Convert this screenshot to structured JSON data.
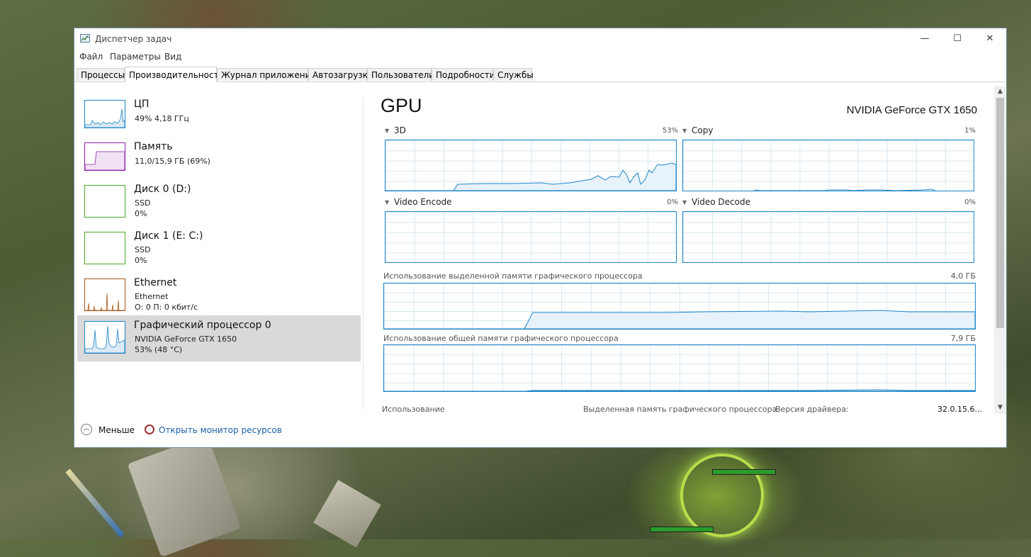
{
  "window": {
    "title": "Диспетчер задач",
    "controls": {
      "minimize": "—",
      "maximize": "☐",
      "close": "✕"
    }
  },
  "menu": [
    "Файл",
    "Параметры",
    "Вид"
  ],
  "tabs": [
    {
      "label": "Процессы",
      "active": false
    },
    {
      "label": "Производительность",
      "active": true
    },
    {
      "label": "Журнал приложений",
      "active": false
    },
    {
      "label": "Автозагрузка",
      "active": false
    },
    {
      "label": "Пользователи",
      "active": false
    },
    {
      "label": "Подробности",
      "active": false
    },
    {
      "label": "Службы",
      "active": false
    }
  ],
  "resources": [
    {
      "title": "ЦП",
      "line1": "49% 4,18 ГГц",
      "line2": "",
      "color": "#1e86c8",
      "selected": false
    },
    {
      "title": "Память",
      "line1": "11,0/15,9 ГБ (69%)",
      "line2": "",
      "color": "#8b1fa8",
      "selected": false
    },
    {
      "title": "Диск 0 (D:)",
      "line1": "SSD",
      "line2": "0%",
      "color": "#4da626",
      "selected": false
    },
    {
      "title": "Диск 1 (E: C:)",
      "line1": "SSD",
      "line2": "0%",
      "color": "#4da626",
      "selected": false
    },
    {
      "title": "Ethernet",
      "line1": "Ethernet",
      "line2": "О: 0 П: 0 кбит/с",
      "color": "#a7581b",
      "selected": false
    },
    {
      "title": "Графический процессор 0",
      "line1": "NVIDIA GeForce GTX 1650",
      "line2": "53% (48 °C)",
      "color": "#1e86c8",
      "selected": true
    }
  ],
  "gpu": {
    "heading": "GPU",
    "model": "NVIDIA GeForce GTX 1650",
    "engines": [
      {
        "label": "3D",
        "percent": "53%"
      },
      {
        "label": "Copy",
        "percent": "1%"
      },
      {
        "label": "Video Encode",
        "percent": "0%"
      },
      {
        "label": "Video Decode",
        "percent": "0%"
      }
    ],
    "dedicated": {
      "label": "Использование выделенной памяти графического процессора",
      "max": "4,0 ГБ"
    },
    "shared": {
      "label": "Использование общей памяти графического процессора",
      "max": "7,9 ГБ"
    }
  },
  "stats": {
    "usage_label": "Использование",
    "dedicated_label": "Выделенная память графического процессора",
    "driver_label": "Версия драйвера:",
    "driver_value": "32.0.15.6..."
  },
  "footer": {
    "less_label": "Меньше",
    "monitor_link": "Открыть монитор ресурсов"
  },
  "colors": {
    "graph_blue": "#1e86c8",
    "memory_purple": "#8b1fa8",
    "disk_green": "#4da626",
    "net_orange": "#a7581b",
    "selected_bg": "#d9d9d9"
  }
}
